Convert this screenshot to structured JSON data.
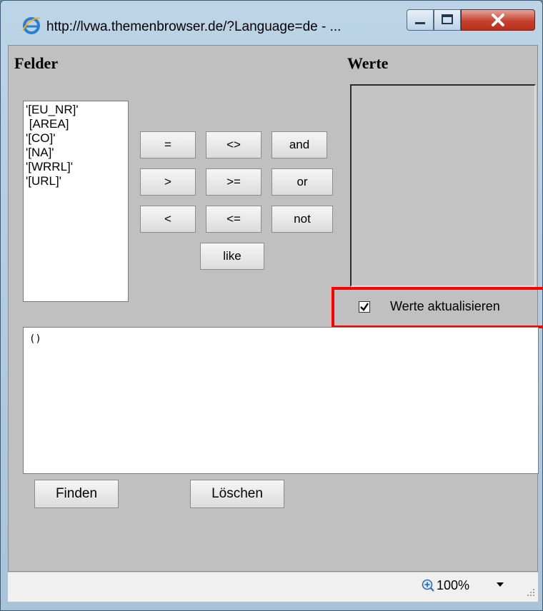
{
  "window": {
    "title": "http://lvwa.themenbrowser.de/?Language=de - ..."
  },
  "panel": {
    "fields_heading": "Felder",
    "values_heading": "Werte",
    "fields": [
      "'[EU_NR]'",
      " [AREA]",
      "'[CO]'",
      "'[NA]'",
      "'[WRRL]'",
      "'[URL]'"
    ],
    "operators": {
      "eq": "=",
      "neq": "<>",
      "and": "and",
      "gt": ">",
      "gte": ">=",
      "or": "or",
      "lt": "<",
      "lte": "<=",
      "not": "not",
      "like": "like"
    },
    "refresh_values_label": "Werte aktualisieren",
    "refresh_values_checked": true,
    "query_text": "()",
    "find_button": "Finden",
    "clear_button": "Löschen"
  },
  "statusbar": {
    "zoom": "100%"
  },
  "colors": {
    "highlight": "#ff0000",
    "panel_bg": "#c0c0c0"
  }
}
